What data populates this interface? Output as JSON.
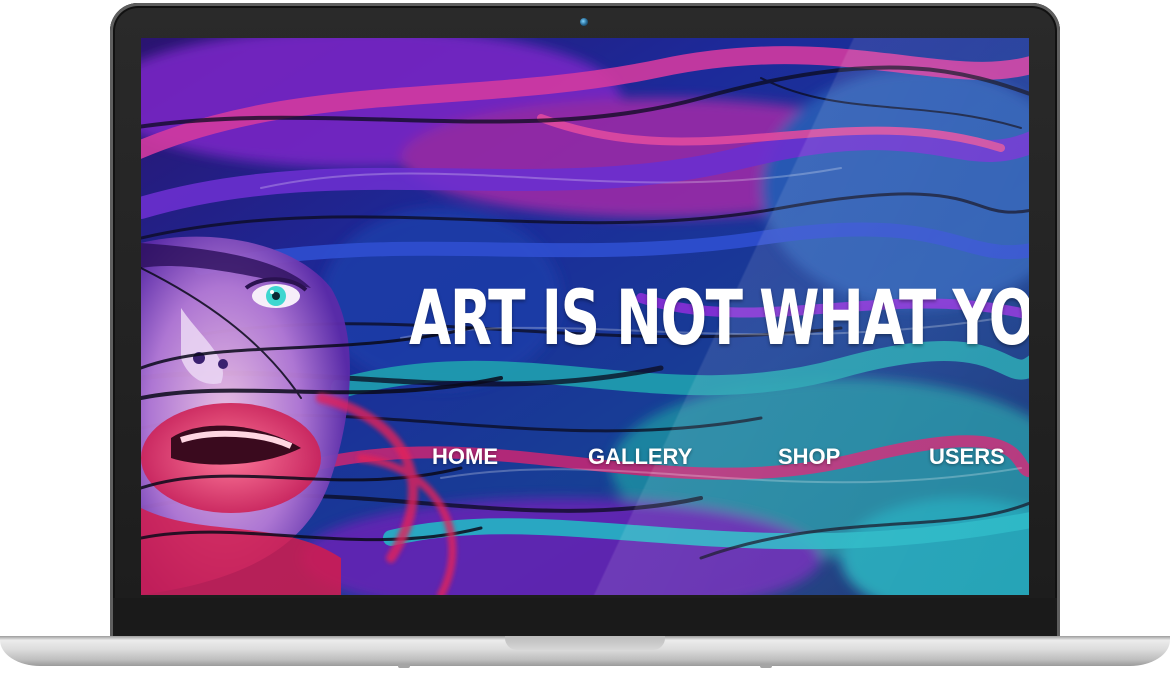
{
  "hero": {
    "headline": "ART IS NOT WHAT YOU SEE"
  },
  "nav": {
    "items": [
      {
        "label": "HOME"
      },
      {
        "label": "GALLERY"
      },
      {
        "label": "SHOP"
      },
      {
        "label": "USERS"
      }
    ]
  },
  "colors": {
    "text": "#ffffff",
    "deep_blue": "#1a2a8a",
    "violet": "#7a2ad0",
    "magenta": "#e0338a",
    "teal": "#1aa6b0",
    "bezel": "#1c1c1c",
    "aluminum": "#d8d8d8"
  }
}
